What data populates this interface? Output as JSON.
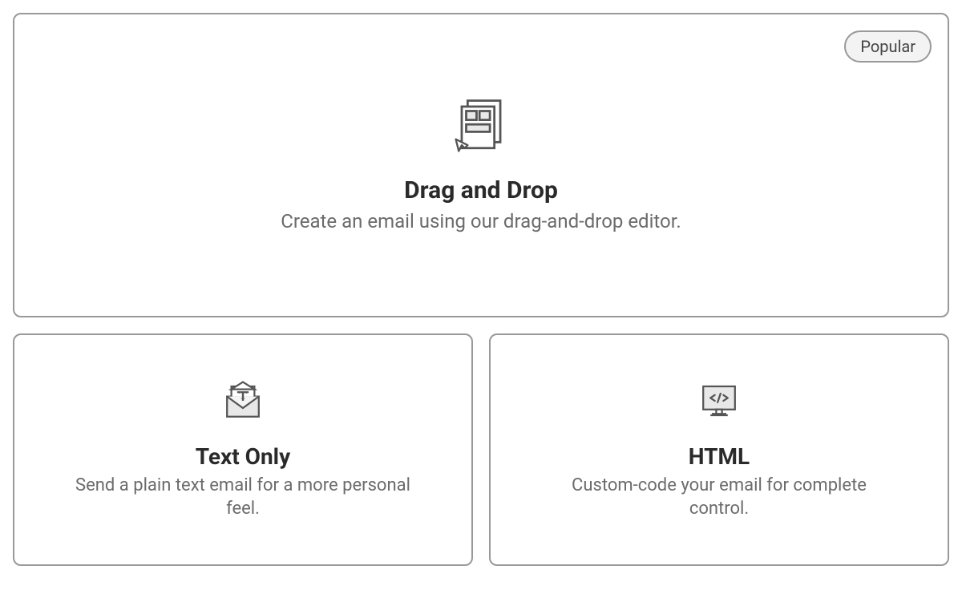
{
  "options": {
    "drag_drop": {
      "badge": "Popular",
      "title": "Drag and Drop",
      "description": "Create an email using our drag-and-drop editor."
    },
    "text_only": {
      "title": "Text Only",
      "description": "Send a plain text email for a more personal feel."
    },
    "html": {
      "title": "HTML",
      "description": "Custom-code your email for complete control."
    }
  }
}
